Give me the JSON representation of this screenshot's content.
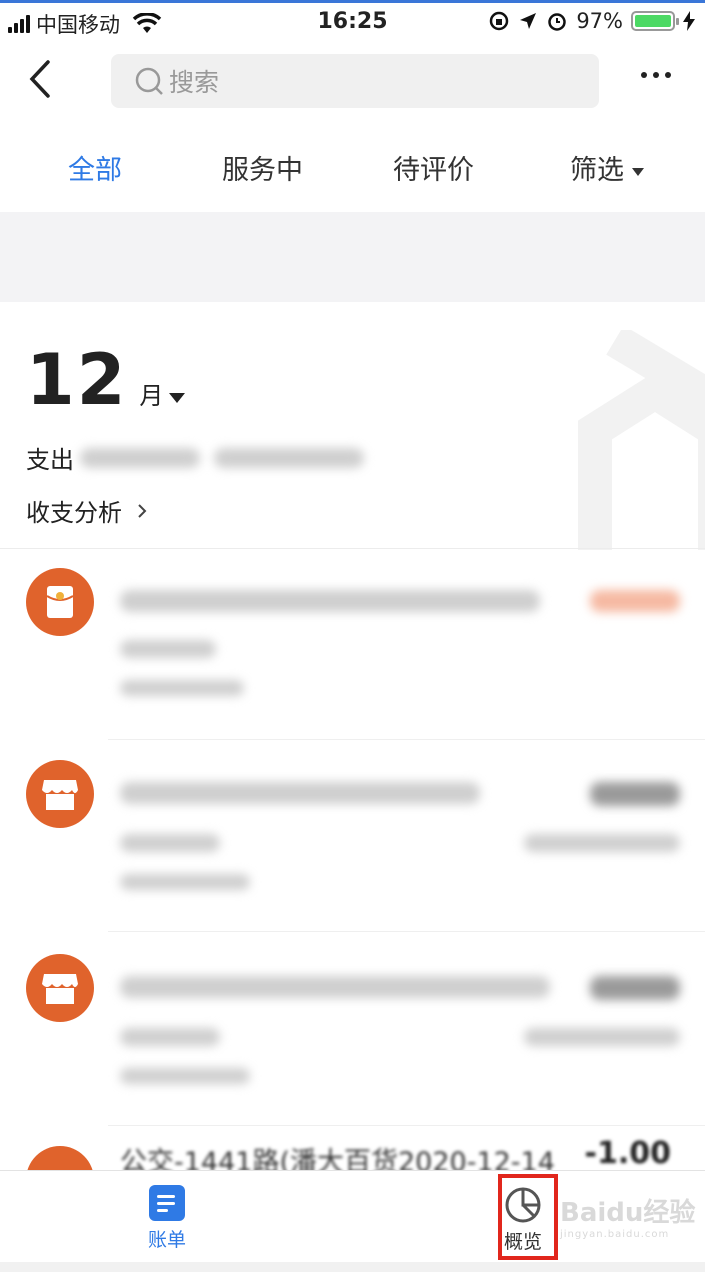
{
  "status_bar": {
    "carrier": "中国移动",
    "time": "16:25",
    "battery": "97%",
    "battery_level": 0.97
  },
  "nav": {
    "search_placeholder": "搜索"
  },
  "tabs": [
    {
      "label": "全部",
      "active": true
    },
    {
      "label": "服务中",
      "active": false
    },
    {
      "label": "待评价",
      "active": false
    },
    {
      "label": "筛选",
      "active": false
    }
  ],
  "summary": {
    "month_number": "12",
    "month_unit": "月",
    "expense_label": "支出",
    "analysis_label": "收支分析"
  },
  "transactions": [
    {
      "icon": "red-envelope-icon",
      "blurred": true
    },
    {
      "icon": "shop-icon",
      "blurred": true
    },
    {
      "icon": "shop-icon",
      "blurred": true
    },
    {
      "icon": "shop-icon",
      "title_partial": "公交-1441路(潘大百货2020-12-14",
      "amount_partial": "-1.00"
    }
  ],
  "tabbar": {
    "bill_label": "账单",
    "overview_label": "概览"
  },
  "watermark": {
    "text": "Baidu经验",
    "sub": "jingyan.baidu.com"
  },
  "colors": {
    "accent": "#2f7ae5",
    "merchant_icon": "#e0632c",
    "highlight_box": "#e1261c"
  }
}
